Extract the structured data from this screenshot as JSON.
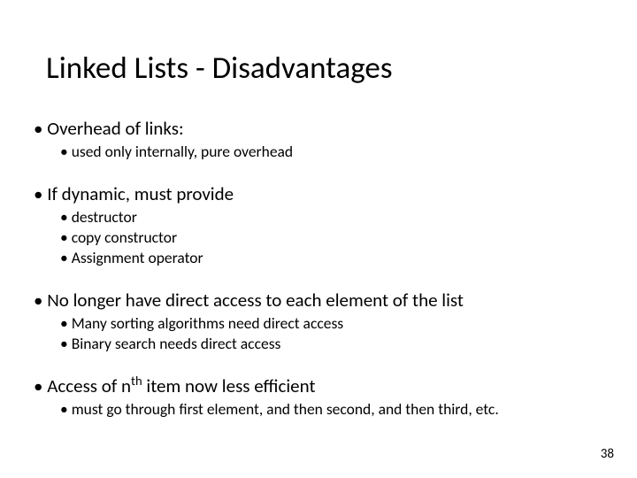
{
  "title": "Linked Lists - Disadvantages",
  "groups": [
    {
      "heading": "Overhead of links:",
      "subs": [
        "used only internally, pure overhead"
      ]
    },
    {
      "heading": "If dynamic, must provide",
      "subs": [
        "destructor",
        "copy constructor",
        "Assignment operator"
      ]
    },
    {
      "heading": "No longer have direct access to each element of the list",
      "subs": [
        "Many sorting algorithms need direct access",
        "Binary search needs direct access"
      ]
    },
    {
      "heading_html": "Access of n<sup>th</sup> item now less efficient",
      "subs": [
        "must go through first element, and then second, and then third, etc."
      ]
    }
  ],
  "page_number": "38"
}
